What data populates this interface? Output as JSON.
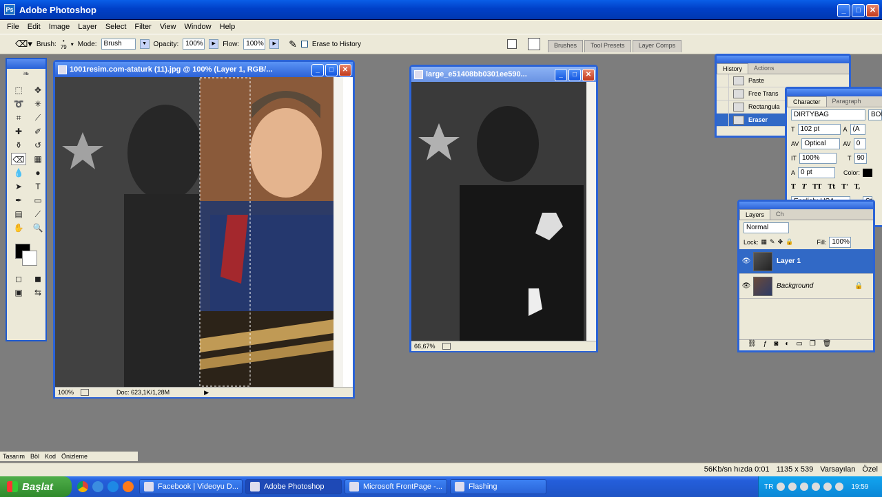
{
  "app": {
    "title": "Adobe Photoshop"
  },
  "menu": [
    "File",
    "Edit",
    "Image",
    "Layer",
    "Select",
    "Filter",
    "View",
    "Window",
    "Help"
  ],
  "options": {
    "brush_label": "Brush:",
    "brush_size": "79",
    "mode_label": "Mode:",
    "mode_value": "Brush",
    "opacity_label": "Opacity:",
    "opacity_value": "100%",
    "flow_label": "Flow:",
    "flow_value": "100%",
    "erase_history": "Erase to History"
  },
  "palette_well": [
    "Brushes",
    "Tool Presets",
    "Layer Comps"
  ],
  "doc1": {
    "title": "1001resim.com-ataturk (11).jpg @ 100% (Layer 1, RGB/...",
    "zoom": "100%",
    "doc_info": "Doc: 623,1K/1,28M"
  },
  "doc2": {
    "title": "large_e51408bb0301ee590...",
    "zoom": "66,67%"
  },
  "history": {
    "tabs": [
      "History",
      "Actions"
    ],
    "items": [
      "Paste",
      "Free Trans",
      "Rectangula",
      "Eraser"
    ]
  },
  "character": {
    "tabs": [
      "Character",
      "Paragraph"
    ],
    "font": "DIRTYBAG",
    "style": "BOI",
    "size": "102 pt",
    "leading": "(A",
    "kerning": "Optical",
    "tracking": "0",
    "vscale": "100%",
    "hscale": "90",
    "baseline": "0 pt",
    "color_label": "Color:",
    "language": "English: USA",
    "aa_label": "a",
    "aa_value": "St",
    "style_buttons": [
      "T",
      "T",
      "TT",
      "Tt",
      "T'",
      "T,"
    ]
  },
  "layers": {
    "tabs": [
      "Layers",
      "Ch"
    ],
    "blend": "Normal",
    "lock_label": "Lock:",
    "fill_label": "Fill:",
    "fill_value": "100%",
    "items": [
      {
        "name": "Layer 1"
      },
      {
        "name": "Background"
      }
    ]
  },
  "bottom_strip": [
    "Tasarım",
    "Böl",
    "Kod",
    "Önizleme"
  ],
  "statusbar": {
    "speed": "56Kb/sn hızda 0:01",
    "size": "1135 x 539",
    "default": "Varsayılan",
    "custom": "Özel"
  },
  "taskbar": {
    "start": "Başlat",
    "tasks": [
      "Facebook | Videoyu D...",
      "Adobe Photoshop",
      "Microsoft FrontPage -...",
      "Flashing"
    ],
    "lang": "TR",
    "time": "19:59"
  }
}
